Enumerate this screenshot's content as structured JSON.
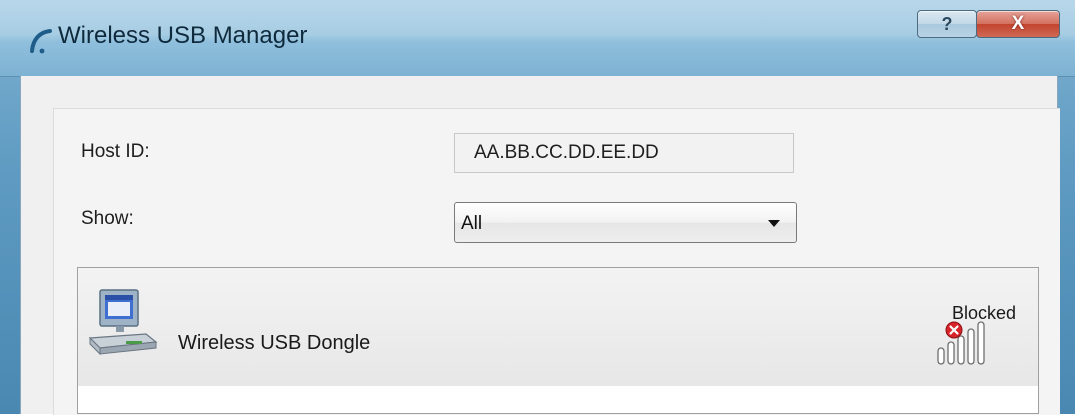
{
  "window": {
    "title": "Wireless USB Manager",
    "icon": "wireless-usb-arc-icon",
    "help_glyph": "?",
    "close_glyph": "X"
  },
  "form": {
    "host_id_label": "Host ID:",
    "host_id_value": "AA.BB.CC.DD.EE.DD",
    "show_label": "Show:",
    "show_value": "All"
  },
  "devices": [
    {
      "name": "Wireless USB Dongle",
      "status": "Blocked",
      "icon": "computer-icon",
      "signal_icon": "signal-blocked-icon"
    }
  ],
  "colors": {
    "blocked_badge": "#d8232a"
  }
}
